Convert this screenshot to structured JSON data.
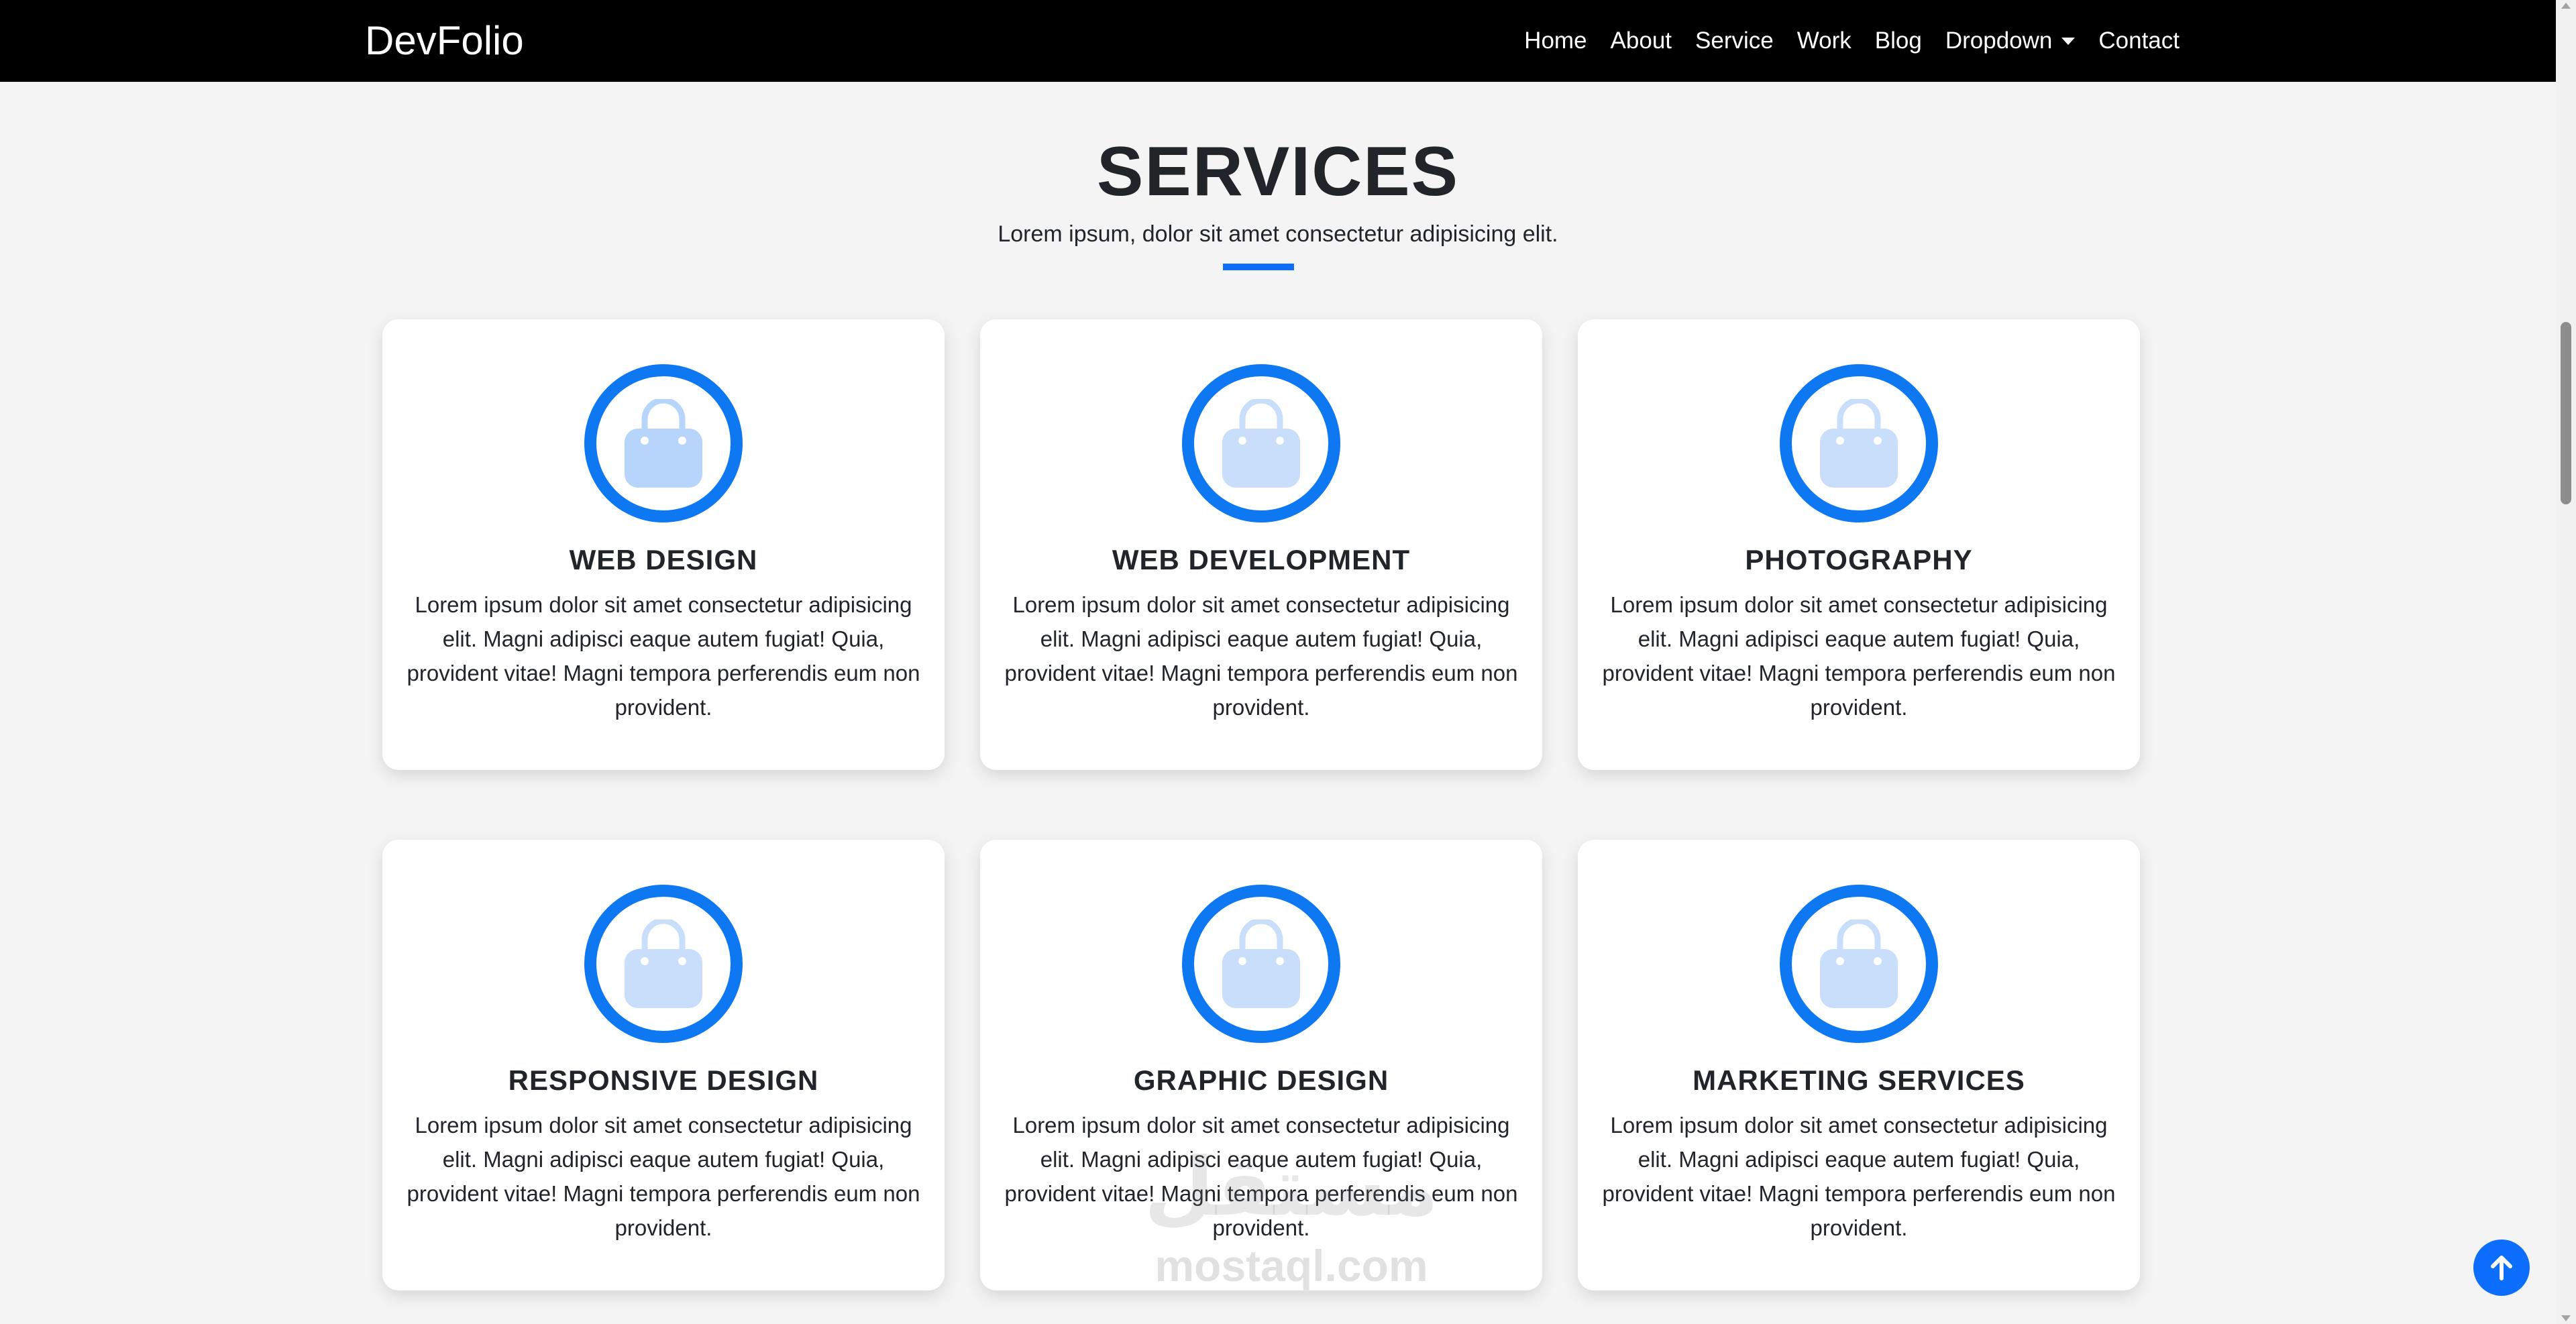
{
  "navbar": {
    "brand": "DevFolio",
    "links": [
      {
        "label": "Home"
      },
      {
        "label": "About"
      },
      {
        "label": "Service"
      },
      {
        "label": "Work"
      },
      {
        "label": "Blog"
      },
      {
        "label": "Dropdown"
      },
      {
        "label": "Contact"
      }
    ]
  },
  "section": {
    "title": "SERVICES",
    "subtitle": "Lorem ipsum, dolor sit amet consectetur adipisicing elit."
  },
  "services": [
    {
      "title": "WEB DESIGN",
      "icon": "shopping-bag-icon",
      "text": "Lorem ipsum dolor sit amet consectetur adipisicing elit. Magni adipisci eaque autem fugiat! Quia, provident vitae! Magni tempora perferendis eum non provident."
    },
    {
      "title": "WEB DEVELOPMENT",
      "icon": "shopping-bag-icon",
      "text": "Lorem ipsum dolor sit amet consectetur adipisicing elit. Magni adipisci eaque autem fugiat! Quia, provident vitae! Magni tempora perferendis eum non provident."
    },
    {
      "title": "PHOTOGRAPHY",
      "icon": "shopping-bag-icon",
      "text": "Lorem ipsum dolor sit amet consectetur adipisicing elit. Magni adipisci eaque autem fugiat! Quia, provident vitae! Magni tempora perferendis eum non provident."
    },
    {
      "title": "RESPONSIVE DESIGN",
      "icon": "shopping-bag-icon",
      "text": "Lorem ipsum dolor sit amet consectetur adipisicing elit. Magni adipisci eaque autem fugiat! Quia, provident vitae! Magni tempora perferendis eum non provident."
    },
    {
      "title": "GRAPHIC DESIGN",
      "icon": "shopping-bag-icon",
      "text": "Lorem ipsum dolor sit amet consectetur adipisicing elit. Magni adipisci eaque autem fugiat! Quia, provident vitae! Magni tempora perferendis eum non provident."
    },
    {
      "title": "MARKETING SERVICES",
      "icon": "shopping-bag-icon",
      "text": "Lorem ipsum dolor sit amet consectetur adipisicing elit. Magni adipisci eaque autem fugiat! Quia, provident vitae! Magni tempora perferendis eum non provident."
    }
  ],
  "watermark": {
    "arabic": "مستقل",
    "latin": "mostaql.com"
  },
  "colors": {
    "accent": "#0d6efd",
    "navbar_bg": "#000000",
    "page_bg": "#f4f4f4",
    "icon_fill": "#c9defa"
  }
}
